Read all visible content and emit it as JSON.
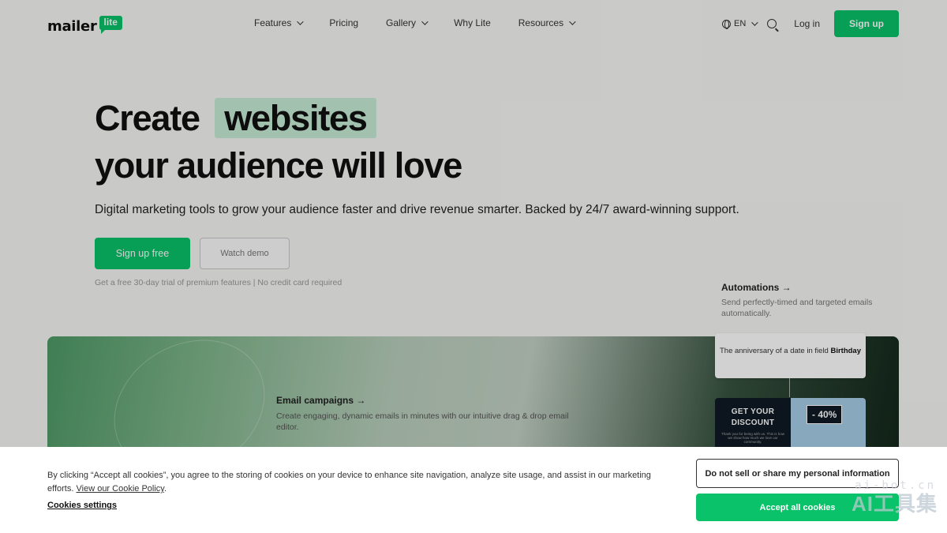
{
  "logo": {
    "word": "mailer",
    "bubble": "lite"
  },
  "nav": {
    "items": [
      {
        "label": "Features",
        "dropdown": true
      },
      {
        "label": "Pricing",
        "dropdown": false
      },
      {
        "label": "Gallery",
        "dropdown": true
      },
      {
        "label": "Why Lite",
        "dropdown": false
      },
      {
        "label": "Resources",
        "dropdown": true
      }
    ],
    "language": "EN",
    "login": "Log in",
    "signup": "Sign up"
  },
  "hero": {
    "title_line1_prefix": "Create",
    "title_highlight": "websites",
    "title_line2": "your audience will love",
    "subtitle": "Digital marketing tools to grow your audience faster and drive revenue smarter. Backed by 24/7 award-winning support.",
    "primary_cta": "Sign up free",
    "secondary_cta": "Watch demo",
    "trial_note": "Get a free 30-day trial of premium features | No credit card required"
  },
  "automations": {
    "title": "Automations →",
    "description": "Send perfectly-timed and targeted emails automatically."
  },
  "email_campaigns": {
    "title": "Email campaigns →",
    "description": "Create engaging, dynamic emails in minutes with our intuitive drag & drop email editor."
  },
  "date_card": {
    "text": "The anniversary of a date in field",
    "field": "Birthday"
  },
  "promo": {
    "title_line1": "GET YOUR",
    "title_line2": "DISCOUNT",
    "small_text": "Thank you for being with us. This is how we show how much we love our community.",
    "badge": "- 40%"
  },
  "cookie_banner": {
    "text": "By clicking “Accept all cookies”, you agree to the storing of cookies on your device to enhance site navigation, analyze site usage, and assist in our marketing efforts.",
    "policy_link": "View our Cookie Policy",
    "settings": "Cookies settings",
    "do_not_sell": "Do not sell or share my personal information",
    "accept": "Accept all cookies"
  },
  "watermark": {
    "small": "ai-bot.cn",
    "large": "AI工具集"
  },
  "colors": {
    "brand_green": "#09c269",
    "highlight": "#c7ecd6"
  }
}
